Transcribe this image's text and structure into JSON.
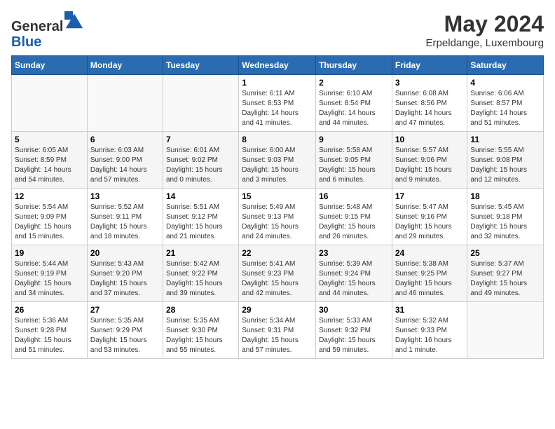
{
  "header": {
    "logo_line1": "General",
    "logo_line2": "Blue",
    "month_title": "May 2024",
    "location": "Erpeldange, Luxembourg"
  },
  "weekdays": [
    "Sunday",
    "Monday",
    "Tuesday",
    "Wednesday",
    "Thursday",
    "Friday",
    "Saturday"
  ],
  "weeks": [
    [
      {
        "day": "",
        "info": ""
      },
      {
        "day": "",
        "info": ""
      },
      {
        "day": "",
        "info": ""
      },
      {
        "day": "1",
        "info": "Sunrise: 6:11 AM\nSunset: 8:53 PM\nDaylight: 14 hours\nand 41 minutes."
      },
      {
        "day": "2",
        "info": "Sunrise: 6:10 AM\nSunset: 8:54 PM\nDaylight: 14 hours\nand 44 minutes."
      },
      {
        "day": "3",
        "info": "Sunrise: 6:08 AM\nSunset: 8:56 PM\nDaylight: 14 hours\nand 47 minutes."
      },
      {
        "day": "4",
        "info": "Sunrise: 6:06 AM\nSunset: 8:57 PM\nDaylight: 14 hours\nand 51 minutes."
      }
    ],
    [
      {
        "day": "5",
        "info": "Sunrise: 6:05 AM\nSunset: 8:59 PM\nDaylight: 14 hours\nand 54 minutes."
      },
      {
        "day": "6",
        "info": "Sunrise: 6:03 AM\nSunset: 9:00 PM\nDaylight: 14 hours\nand 57 minutes."
      },
      {
        "day": "7",
        "info": "Sunrise: 6:01 AM\nSunset: 9:02 PM\nDaylight: 15 hours\nand 0 minutes."
      },
      {
        "day": "8",
        "info": "Sunrise: 6:00 AM\nSunset: 9:03 PM\nDaylight: 15 hours\nand 3 minutes."
      },
      {
        "day": "9",
        "info": "Sunrise: 5:58 AM\nSunset: 9:05 PM\nDaylight: 15 hours\nand 6 minutes."
      },
      {
        "day": "10",
        "info": "Sunrise: 5:57 AM\nSunset: 9:06 PM\nDaylight: 15 hours\nand 9 minutes."
      },
      {
        "day": "11",
        "info": "Sunrise: 5:55 AM\nSunset: 9:08 PM\nDaylight: 15 hours\nand 12 minutes."
      }
    ],
    [
      {
        "day": "12",
        "info": "Sunrise: 5:54 AM\nSunset: 9:09 PM\nDaylight: 15 hours\nand 15 minutes."
      },
      {
        "day": "13",
        "info": "Sunrise: 5:52 AM\nSunset: 9:11 PM\nDaylight: 15 hours\nand 18 minutes."
      },
      {
        "day": "14",
        "info": "Sunrise: 5:51 AM\nSunset: 9:12 PM\nDaylight: 15 hours\nand 21 minutes."
      },
      {
        "day": "15",
        "info": "Sunrise: 5:49 AM\nSunset: 9:13 PM\nDaylight: 15 hours\nand 24 minutes."
      },
      {
        "day": "16",
        "info": "Sunrise: 5:48 AM\nSunset: 9:15 PM\nDaylight: 15 hours\nand 26 minutes."
      },
      {
        "day": "17",
        "info": "Sunrise: 5:47 AM\nSunset: 9:16 PM\nDaylight: 15 hours\nand 29 minutes."
      },
      {
        "day": "18",
        "info": "Sunrise: 5:45 AM\nSunset: 9:18 PM\nDaylight: 15 hours\nand 32 minutes."
      }
    ],
    [
      {
        "day": "19",
        "info": "Sunrise: 5:44 AM\nSunset: 9:19 PM\nDaylight: 15 hours\nand 34 minutes."
      },
      {
        "day": "20",
        "info": "Sunrise: 5:43 AM\nSunset: 9:20 PM\nDaylight: 15 hours\nand 37 minutes."
      },
      {
        "day": "21",
        "info": "Sunrise: 5:42 AM\nSunset: 9:22 PM\nDaylight: 15 hours\nand 39 minutes."
      },
      {
        "day": "22",
        "info": "Sunrise: 5:41 AM\nSunset: 9:23 PM\nDaylight: 15 hours\nand 42 minutes."
      },
      {
        "day": "23",
        "info": "Sunrise: 5:39 AM\nSunset: 9:24 PM\nDaylight: 15 hours\nand 44 minutes."
      },
      {
        "day": "24",
        "info": "Sunrise: 5:38 AM\nSunset: 9:25 PM\nDaylight: 15 hours\nand 46 minutes."
      },
      {
        "day": "25",
        "info": "Sunrise: 5:37 AM\nSunset: 9:27 PM\nDaylight: 15 hours\nand 49 minutes."
      }
    ],
    [
      {
        "day": "26",
        "info": "Sunrise: 5:36 AM\nSunset: 9:28 PM\nDaylight: 15 hours\nand 51 minutes."
      },
      {
        "day": "27",
        "info": "Sunrise: 5:35 AM\nSunset: 9:29 PM\nDaylight: 15 hours\nand 53 minutes."
      },
      {
        "day": "28",
        "info": "Sunrise: 5:35 AM\nSunset: 9:30 PM\nDaylight: 15 hours\nand 55 minutes."
      },
      {
        "day": "29",
        "info": "Sunrise: 5:34 AM\nSunset: 9:31 PM\nDaylight: 15 hours\nand 57 minutes."
      },
      {
        "day": "30",
        "info": "Sunrise: 5:33 AM\nSunset: 9:32 PM\nDaylight: 15 hours\nand 59 minutes."
      },
      {
        "day": "31",
        "info": "Sunrise: 5:32 AM\nSunset: 9:33 PM\nDaylight: 16 hours\nand 1 minute."
      },
      {
        "day": "",
        "info": ""
      }
    ]
  ]
}
